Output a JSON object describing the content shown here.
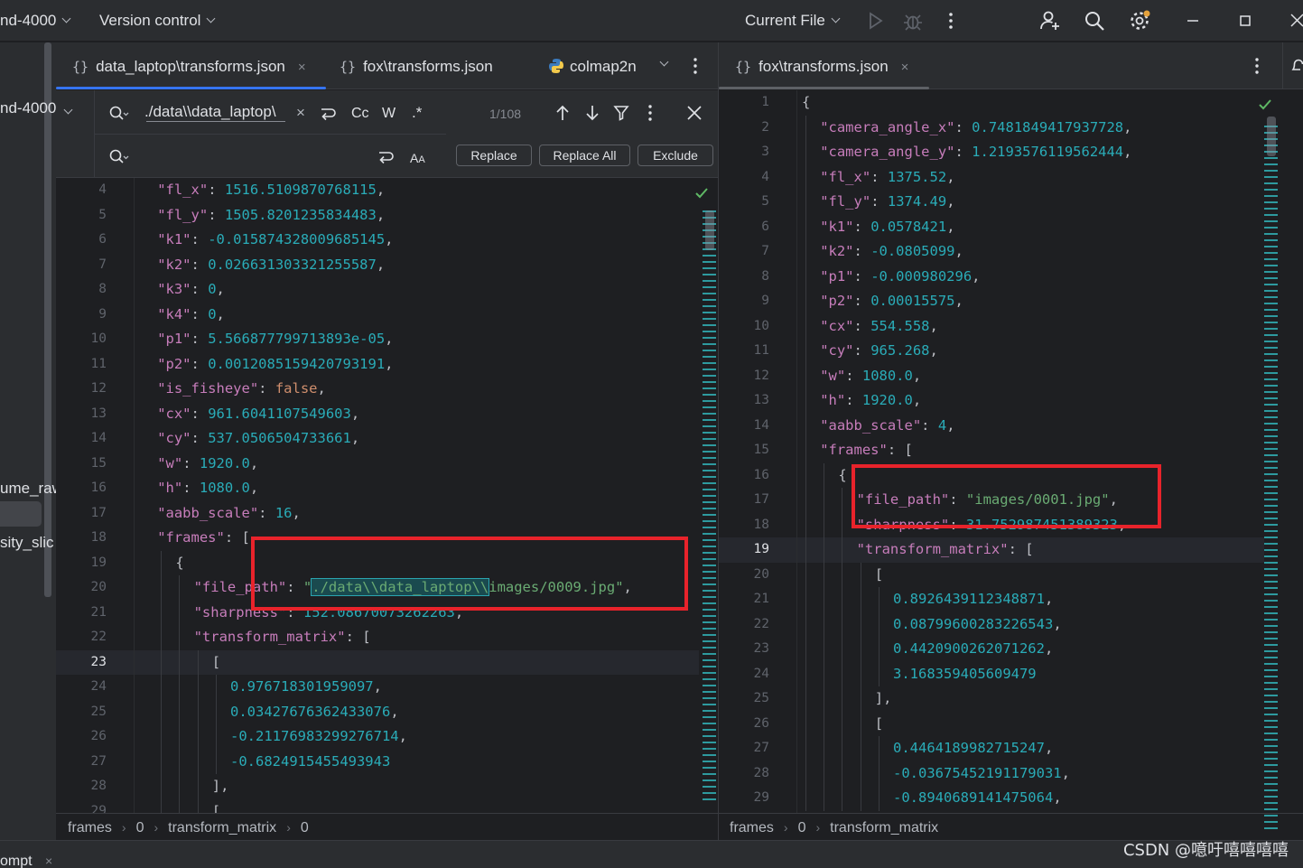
{
  "titlebar": {
    "project": "nd-4000",
    "vcs": "Version control",
    "run_config": "Current File"
  },
  "left_strip": {
    "items": [
      "nd-4000",
      "ume_raw",
      "sity_slic"
    ],
    "bottom_tab": "ompt",
    "bottom_tab_close": "×"
  },
  "left_pane": {
    "tabs": [
      {
        "label": "data_laptop\\transforms.json",
        "close": "×"
      },
      {
        "label": "fox\\transforms.json"
      },
      {
        "label": "colmap2n"
      }
    ],
    "find": {
      "search_value": "./data\\\\data_laptop\\",
      "count": "1/108",
      "replace_placeholder": "",
      "case_label": "Cc",
      "word_label": "W",
      "regex_label": ".*",
      "replace_btn": "Replace",
      "replace_all_btn": "Replace All",
      "exclude_btn": "Exclude"
    },
    "lines": [
      {
        "n": "4",
        "t": [
          [
            "k",
            "\"fl_x\""
          ],
          [
            "p",
            ": "
          ],
          [
            "n",
            "1516.5109870768115"
          ],
          [
            "p",
            ","
          ]
        ],
        "indent": 1
      },
      {
        "n": "5",
        "t": [
          [
            "k",
            "\"fl_y\""
          ],
          [
            "p",
            ": "
          ],
          [
            "n",
            "1505.8201235834483"
          ],
          [
            "p",
            ","
          ]
        ],
        "indent": 1
      },
      {
        "n": "6",
        "t": [
          [
            "k",
            "\"k1\""
          ],
          [
            "p",
            ": "
          ],
          [
            "n",
            "-0.015874328009685145"
          ],
          [
            "p",
            ","
          ]
        ],
        "indent": 1
      },
      {
        "n": "7",
        "t": [
          [
            "k",
            "\"k2\""
          ],
          [
            "p",
            ": "
          ],
          [
            "n",
            "0.026631303321255587"
          ],
          [
            "p",
            ","
          ]
        ],
        "indent": 1
      },
      {
        "n": "8",
        "t": [
          [
            "k",
            "\"k3\""
          ],
          [
            "p",
            ": "
          ],
          [
            "n",
            "0"
          ],
          [
            "p",
            ","
          ]
        ],
        "indent": 1
      },
      {
        "n": "9",
        "t": [
          [
            "k",
            "\"k4\""
          ],
          [
            "p",
            ": "
          ],
          [
            "n",
            "0"
          ],
          [
            "p",
            ","
          ]
        ],
        "indent": 1
      },
      {
        "n": "10",
        "t": [
          [
            "k",
            "\"p1\""
          ],
          [
            "p",
            ": "
          ],
          [
            "n",
            "5.566877799713893e-05"
          ],
          [
            "p",
            ","
          ]
        ],
        "indent": 1
      },
      {
        "n": "11",
        "t": [
          [
            "k",
            "\"p2\""
          ],
          [
            "p",
            ": "
          ],
          [
            "n",
            "0.0012085159420793191"
          ],
          [
            "p",
            ","
          ]
        ],
        "indent": 1
      },
      {
        "n": "12",
        "t": [
          [
            "k",
            "\"is_fisheye\""
          ],
          [
            "p",
            ": "
          ],
          [
            "kw",
            "false"
          ],
          [
            "p",
            ","
          ]
        ],
        "indent": 1
      },
      {
        "n": "13",
        "t": [
          [
            "k",
            "\"cx\""
          ],
          [
            "p",
            ": "
          ],
          [
            "n",
            "961.6041107549603"
          ],
          [
            "p",
            ","
          ]
        ],
        "indent": 1
      },
      {
        "n": "14",
        "t": [
          [
            "k",
            "\"cy\""
          ],
          [
            "p",
            ": "
          ],
          [
            "n",
            "537.0506504733661"
          ],
          [
            "p",
            ","
          ]
        ],
        "indent": 1
      },
      {
        "n": "15",
        "t": [
          [
            "k",
            "\"w\""
          ],
          [
            "p",
            ": "
          ],
          [
            "n",
            "1920.0"
          ],
          [
            "p",
            ","
          ]
        ],
        "indent": 1
      },
      {
        "n": "16",
        "t": [
          [
            "k",
            "\"h\""
          ],
          [
            "p",
            ": "
          ],
          [
            "n",
            "1080.0"
          ],
          [
            "p",
            ","
          ]
        ],
        "indent": 1
      },
      {
        "n": "17",
        "t": [
          [
            "k",
            "\"aabb_scale\""
          ],
          [
            "p",
            ": "
          ],
          [
            "n",
            "16"
          ],
          [
            "p",
            ","
          ]
        ],
        "indent": 1
      },
      {
        "n": "18",
        "t": [
          [
            "k",
            "\"frames\""
          ],
          [
            "p",
            ": ["
          ]
        ],
        "indent": 1
      },
      {
        "n": "19",
        "t": [
          [
            "p",
            "{"
          ]
        ],
        "indent": 2
      },
      {
        "n": "20",
        "t": [
          [
            "k",
            "\"file_path\""
          ],
          [
            "p",
            ": "
          ],
          [
            "s",
            "\""
          ],
          [
            "m",
            "./data\\\\data_laptop\\\\"
          ],
          [
            "s",
            "images/0009.jpg\""
          ],
          [
            "p",
            ","
          ]
        ],
        "indent": 3
      },
      {
        "n": "21",
        "t": [
          [
            "k",
            "\"sharpness\""
          ],
          [
            "p",
            ": "
          ],
          [
            "n",
            "152.08670073262263"
          ],
          [
            "p",
            ","
          ]
        ],
        "indent": 3
      },
      {
        "n": "22",
        "t": [
          [
            "k",
            "\"transform_matrix\""
          ],
          [
            "p",
            ": ["
          ]
        ],
        "indent": 3
      },
      {
        "n": "23",
        "t": [
          [
            "p",
            "["
          ]
        ],
        "indent": 4,
        "current": true
      },
      {
        "n": "24",
        "t": [
          [
            "n",
            "0.976718301959097"
          ],
          [
            "p",
            ","
          ]
        ],
        "indent": 5
      },
      {
        "n": "25",
        "t": [
          [
            "n",
            "0.03427676362433076"
          ],
          [
            "p",
            ","
          ]
        ],
        "indent": 5
      },
      {
        "n": "26",
        "t": [
          [
            "n",
            "-0.21176983299276714"
          ],
          [
            "p",
            ","
          ]
        ],
        "indent": 5
      },
      {
        "n": "27",
        "t": [
          [
            "n",
            "-0.6824915455493943"
          ]
        ],
        "indent": 5
      },
      {
        "n": "28",
        "t": [
          [
            "p",
            "],"
          ]
        ],
        "indent": 4
      },
      {
        "n": "29",
        "t": [
          [
            "p",
            "["
          ]
        ],
        "indent": 4
      }
    ],
    "breadcrumb": [
      "frames",
      "0",
      "transform_matrix",
      "0"
    ]
  },
  "right_pane": {
    "tab": {
      "label": "fox\\transforms.json",
      "close": "×"
    },
    "lines": [
      {
        "n": "1",
        "t": [
          [
            "p",
            "{"
          ]
        ],
        "indent": 0
      },
      {
        "n": "2",
        "t": [
          [
            "k",
            "\"camera_angle_x\""
          ],
          [
            "p",
            ": "
          ],
          [
            "n",
            "0.7481849417937728"
          ],
          [
            "p",
            ","
          ]
        ],
        "indent": 1
      },
      {
        "n": "3",
        "t": [
          [
            "k",
            "\"camera_angle_y\""
          ],
          [
            "p",
            ": "
          ],
          [
            "n",
            "1.2193576119562444"
          ],
          [
            "p",
            ","
          ]
        ],
        "indent": 1
      },
      {
        "n": "4",
        "t": [
          [
            "k",
            "\"fl_x\""
          ],
          [
            "p",
            ": "
          ],
          [
            "n",
            "1375.52"
          ],
          [
            "p",
            ","
          ]
        ],
        "indent": 1
      },
      {
        "n": "5",
        "t": [
          [
            "k",
            "\"fl_y\""
          ],
          [
            "p",
            ": "
          ],
          [
            "n",
            "1374.49"
          ],
          [
            "p",
            ","
          ]
        ],
        "indent": 1
      },
      {
        "n": "6",
        "t": [
          [
            "k",
            "\"k1\""
          ],
          [
            "p",
            ": "
          ],
          [
            "n",
            "0.0578421"
          ],
          [
            "p",
            ","
          ]
        ],
        "indent": 1
      },
      {
        "n": "7",
        "t": [
          [
            "k",
            "\"k2\""
          ],
          [
            "p",
            ": "
          ],
          [
            "n",
            "-0.0805099"
          ],
          [
            "p",
            ","
          ]
        ],
        "indent": 1
      },
      {
        "n": "8",
        "t": [
          [
            "k",
            "\"p1\""
          ],
          [
            "p",
            ": "
          ],
          [
            "n",
            "-0.000980296"
          ],
          [
            "p",
            ","
          ]
        ],
        "indent": 1
      },
      {
        "n": "9",
        "t": [
          [
            "k",
            "\"p2\""
          ],
          [
            "p",
            ": "
          ],
          [
            "n",
            "0.00015575"
          ],
          [
            "p",
            ","
          ]
        ],
        "indent": 1
      },
      {
        "n": "10",
        "t": [
          [
            "k",
            "\"cx\""
          ],
          [
            "p",
            ": "
          ],
          [
            "n",
            "554.558"
          ],
          [
            "p",
            ","
          ]
        ],
        "indent": 1
      },
      {
        "n": "11",
        "t": [
          [
            "k",
            "\"cy\""
          ],
          [
            "p",
            ": "
          ],
          [
            "n",
            "965.268"
          ],
          [
            "p",
            ","
          ]
        ],
        "indent": 1
      },
      {
        "n": "12",
        "t": [
          [
            "k",
            "\"w\""
          ],
          [
            "p",
            ": "
          ],
          [
            "n",
            "1080.0"
          ],
          [
            "p",
            ","
          ]
        ],
        "indent": 1
      },
      {
        "n": "13",
        "t": [
          [
            "k",
            "\"h\""
          ],
          [
            "p",
            ": "
          ],
          [
            "n",
            "1920.0"
          ],
          [
            "p",
            ","
          ]
        ],
        "indent": 1
      },
      {
        "n": "14",
        "t": [
          [
            "k",
            "\"aabb_scale\""
          ],
          [
            "p",
            ": "
          ],
          [
            "n",
            "4"
          ],
          [
            "p",
            ","
          ]
        ],
        "indent": 1
      },
      {
        "n": "15",
        "t": [
          [
            "k",
            "\"frames\""
          ],
          [
            "p",
            ": ["
          ]
        ],
        "indent": 1
      },
      {
        "n": "16",
        "t": [
          [
            "p",
            "{"
          ]
        ],
        "indent": 2
      },
      {
        "n": "17",
        "t": [
          [
            "k",
            "\"file_path\""
          ],
          [
            "p",
            ": "
          ],
          [
            "s",
            "\"images/0001.jpg\""
          ],
          [
            "p",
            ","
          ]
        ],
        "indent": 3
      },
      {
        "n": "18",
        "t": [
          [
            "k",
            "\"sharpness\""
          ],
          [
            "p",
            ": "
          ],
          [
            "n",
            "31.752987451389323"
          ],
          [
            "p",
            ","
          ]
        ],
        "indent": 3
      },
      {
        "n": "19",
        "t": [
          [
            "k",
            "\"transform_matrix\""
          ],
          [
            "p",
            ": ["
          ]
        ],
        "indent": 3,
        "current": true
      },
      {
        "n": "20",
        "t": [
          [
            "p",
            "["
          ]
        ],
        "indent": 4
      },
      {
        "n": "21",
        "t": [
          [
            "n",
            "0.8926439112348871"
          ],
          [
            "p",
            ","
          ]
        ],
        "indent": 5
      },
      {
        "n": "22",
        "t": [
          [
            "n",
            "0.08799600283226543"
          ],
          [
            "p",
            ","
          ]
        ],
        "indent": 5
      },
      {
        "n": "23",
        "t": [
          [
            "n",
            "0.4420900262071262"
          ],
          [
            "p",
            ","
          ]
        ],
        "indent": 5
      },
      {
        "n": "24",
        "t": [
          [
            "n",
            "3.168359405609479"
          ]
        ],
        "indent": 5
      },
      {
        "n": "25",
        "t": [
          [
            "p",
            "],"
          ]
        ],
        "indent": 4
      },
      {
        "n": "26",
        "t": [
          [
            "p",
            "["
          ]
        ],
        "indent": 4
      },
      {
        "n": "27",
        "t": [
          [
            "n",
            "0.4464189982715247"
          ],
          [
            "p",
            ","
          ]
        ],
        "indent": 5
      },
      {
        "n": "28",
        "t": [
          [
            "n",
            "-0.03675452191179031"
          ],
          [
            "p",
            ","
          ]
        ],
        "indent": 5
      },
      {
        "n": "29",
        "t": [
          [
            "n",
            "-0.8940689141475064"
          ],
          [
            "p",
            ","
          ]
        ],
        "indent": 5
      }
    ],
    "breadcrumb": [
      "frames",
      "0",
      "transform_matrix"
    ]
  },
  "watermark": "CSDN @噫吁嘻嘻嘻嘻",
  "colors": {
    "accent": "#3574f0",
    "annotation_red": "#e8232b",
    "json_key": "#c77dbb",
    "json_number": "#2aacb8",
    "json_string": "#6aab73",
    "json_keyword": "#cf8e6d"
  }
}
